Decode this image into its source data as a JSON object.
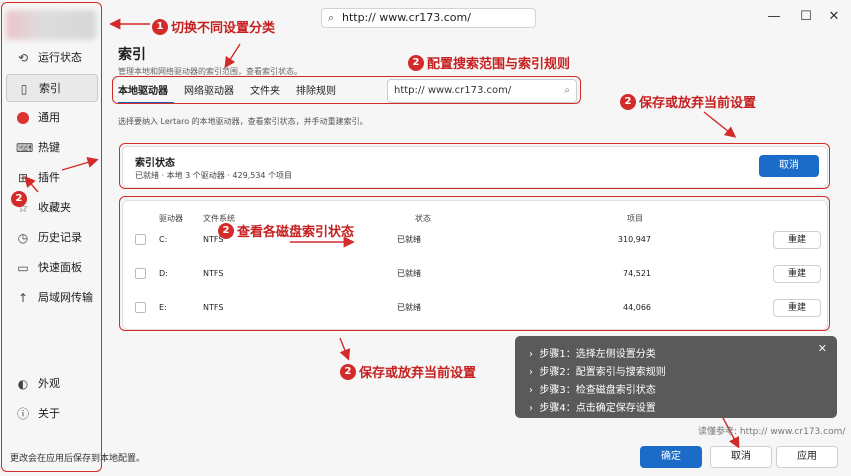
{
  "title_bar": {
    "address": "http:// www.cr173.com/",
    "minimize": "—",
    "maximize": "☐",
    "close": "✕"
  },
  "sidebar": {
    "items": [
      {
        "label": "运行状态",
        "icon": "status-icon"
      },
      {
        "label": "索引",
        "icon": "index-icon"
      },
      {
        "label": "通用",
        "icon": "general-icon"
      },
      {
        "label": "热键",
        "icon": "hotkey-icon"
      },
      {
        "label": "插件",
        "icon": "plugin-icon"
      },
      {
        "label": "收藏夹",
        "icon": "favorites-icon"
      },
      {
        "label": "历史记录",
        "icon": "history-icon"
      },
      {
        "label": "快速面板",
        "icon": "quick-panel-icon"
      },
      {
        "label": "局域网传输",
        "icon": "lan-transfer-icon"
      },
      {
        "label": "外观",
        "icon": "appearance-icon"
      },
      {
        "label": "关于",
        "icon": "about-icon"
      }
    ],
    "footer": "更改会在应用后保存到本地配置。"
  },
  "main": {
    "title": "索引",
    "subtitle": "管理本地和网络驱动器的索引范围，查看索引状态。",
    "tabs": [
      "本地驱动器",
      "网络驱动器",
      "文件夹",
      "排除规则"
    ],
    "search_value": "http:// www.cr173.com/",
    "description": "选择要纳入 Lertaro 的本地驱动器，查看索引状态，并手动重建索引。",
    "status_card": {
      "title": "索引状态",
      "text": "已就绪 · 本地 3 个驱动器 · 429,534 个项目",
      "button": "取消"
    },
    "table": {
      "headers": [
        "驱动器",
        "文件系统",
        "状态",
        "项目"
      ],
      "rows": [
        {
          "drive": "C:",
          "fs": "NTFS",
          "status": "已就绪",
          "items": "310,947",
          "action": "重建"
        },
        {
          "drive": "D:",
          "fs": "NTFS",
          "status": "已就绪",
          "items": "74,521",
          "action": "重建"
        },
        {
          "drive": "E:",
          "fs": "NTFS",
          "status": "已就绪",
          "items": "44,066",
          "action": "重建"
        }
      ]
    },
    "footer_buttons": {
      "ok": "确定",
      "cancel": "取消",
      "apply": "应用"
    }
  },
  "annotations": {
    "a1": {
      "num": "1",
      "text": "切换不同设置分类"
    },
    "a2_search": {
      "num": "2",
      "text": "配置搜索范围与索引规则"
    },
    "a2_save_top": {
      "num": "2",
      "text": "保存或放弃当前设置"
    },
    "a2_plugin": {
      "num": "2",
      "text": ""
    },
    "a2_disk": {
      "num": "2",
      "text": "查看各磁盘索引状态"
    },
    "a2_save_bottom": {
      "num": "2",
      "text": "保存或放弃当前设置"
    }
  },
  "steps_panel": {
    "close": "✕",
    "steps": [
      "步骤1：选择左侧设置分类",
      "步骤2：配置索引与搜索规则",
      "步骤3：检查磁盘索引状态",
      "步骤4：点击确定保存设置"
    ]
  },
  "watermark": "读懂参考: http:// www.cr173.com/",
  "colors": {
    "accent": "#1a6cc8",
    "annotation": "#d32a2a"
  }
}
